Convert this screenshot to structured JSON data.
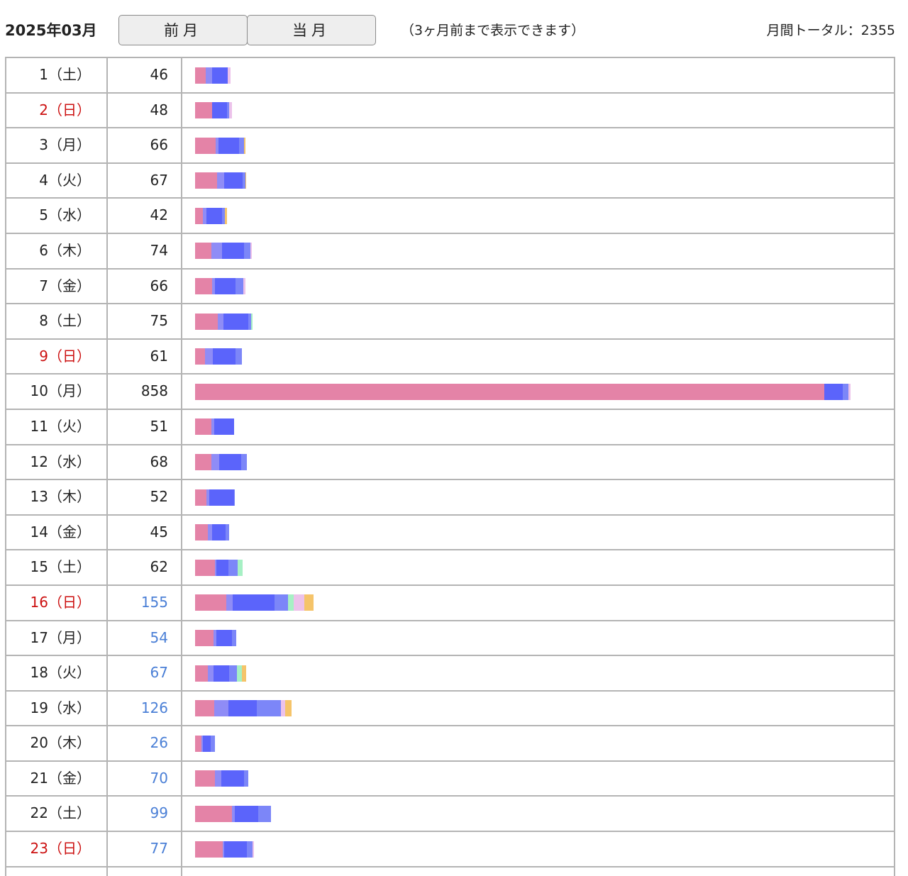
{
  "header": {
    "month_title": "2025年03月",
    "prev_label": "前月",
    "current_label": "当月",
    "note": "（3ヶ月前まで表示できます）",
    "total_label": "月間トータル：2355"
  },
  "colors": {
    "pink": "#e483a7",
    "lavender": "#8f8cf6",
    "blue": "#5b64fb",
    "periwinkle": "#7c86f8",
    "mint": "#a6f0c4",
    "light_pink": "#ecc2ea",
    "orange": "#f5c46a",
    "sunday_text": "#cc1111",
    "count_highlight": "#4a7fd6",
    "grid": "#b4b4b4"
  },
  "chart_data": {
    "type": "bar",
    "x_max": 858,
    "rows": [
      {
        "day": "1（土）",
        "count": "46",
        "value": 46,
        "sunday": false,
        "blue": false,
        "segments": [
          {
            "color": "pink",
            "v": 14
          },
          {
            "color": "lavender",
            "v": 8
          },
          {
            "color": "blue",
            "v": 21
          },
          {
            "color": "light_pink",
            "v": 3
          }
        ]
      },
      {
        "day": "2（日）",
        "count": "48",
        "value": 48,
        "sunday": true,
        "blue": false,
        "segments": [
          {
            "color": "pink",
            "v": 22
          },
          {
            "color": "blue",
            "v": 20
          },
          {
            "color": "periwinkle",
            "v": 3
          },
          {
            "color": "light_pink",
            "v": 3
          }
        ]
      },
      {
        "day": "3（月）",
        "count": "66",
        "value": 66,
        "sunday": false,
        "blue": false,
        "segments": [
          {
            "color": "pink",
            "v": 27
          },
          {
            "color": "lavender",
            "v": 4
          },
          {
            "color": "blue",
            "v": 27
          },
          {
            "color": "periwinkle",
            "v": 6
          },
          {
            "color": "orange",
            "v": 2
          }
        ]
      },
      {
        "day": "4（火）",
        "count": "67",
        "value": 67,
        "sunday": false,
        "blue": false,
        "segments": [
          {
            "color": "pink",
            "v": 29
          },
          {
            "color": "lavender",
            "v": 9
          },
          {
            "color": "blue",
            "v": 24
          },
          {
            "color": "periwinkle",
            "v": 4
          },
          {
            "color": "orange",
            "v": 1
          }
        ]
      },
      {
        "day": "5（水）",
        "count": "42",
        "value": 42,
        "sunday": false,
        "blue": false,
        "segments": [
          {
            "color": "pink",
            "v": 10
          },
          {
            "color": "lavender",
            "v": 5
          },
          {
            "color": "blue",
            "v": 20
          },
          {
            "color": "periwinkle",
            "v": 4
          },
          {
            "color": "orange",
            "v": 3
          }
        ]
      },
      {
        "day": "6（木）",
        "count": "74",
        "value": 74,
        "sunday": false,
        "blue": false,
        "segments": [
          {
            "color": "pink",
            "v": 21
          },
          {
            "color": "lavender",
            "v": 14
          },
          {
            "color": "blue",
            "v": 29
          },
          {
            "color": "periwinkle",
            "v": 8
          },
          {
            "color": "light_pink",
            "v": 2
          }
        ]
      },
      {
        "day": "7（金）",
        "count": "66",
        "value": 66,
        "sunday": false,
        "blue": false,
        "segments": [
          {
            "color": "pink",
            "v": 22
          },
          {
            "color": "lavender",
            "v": 4
          },
          {
            "color": "blue",
            "v": 27
          },
          {
            "color": "periwinkle",
            "v": 10
          },
          {
            "color": "light_pink",
            "v": 3
          }
        ]
      },
      {
        "day": "8（土）",
        "count": "75",
        "value": 75,
        "sunday": false,
        "blue": false,
        "segments": [
          {
            "color": "pink",
            "v": 30
          },
          {
            "color": "lavender",
            "v": 7
          },
          {
            "color": "blue",
            "v": 33
          },
          {
            "color": "periwinkle",
            "v": 3
          },
          {
            "color": "mint",
            "v": 2
          }
        ]
      },
      {
        "day": "9（日）",
        "count": "61",
        "value": 61,
        "sunday": true,
        "blue": false,
        "segments": [
          {
            "color": "pink",
            "v": 13
          },
          {
            "color": "lavender",
            "v": 10
          },
          {
            "color": "blue",
            "v": 30
          },
          {
            "color": "periwinkle",
            "v": 8
          }
        ]
      },
      {
        "day": "10（月）",
        "count": "858",
        "value": 858,
        "sunday": false,
        "blue": false,
        "segments": [
          {
            "color": "pink",
            "v": 824
          },
          {
            "color": "blue",
            "v": 24
          },
          {
            "color": "periwinkle",
            "v": 7
          },
          {
            "color": "light_pink",
            "v": 3
          }
        ]
      },
      {
        "day": "11（火）",
        "count": "51",
        "value": 51,
        "sunday": false,
        "blue": false,
        "segments": [
          {
            "color": "pink",
            "v": 21
          },
          {
            "color": "lavender",
            "v": 4
          },
          {
            "color": "blue",
            "v": 26
          }
        ]
      },
      {
        "day": "12（水）",
        "count": "68",
        "value": 68,
        "sunday": false,
        "blue": false,
        "segments": [
          {
            "color": "pink",
            "v": 21
          },
          {
            "color": "lavender",
            "v": 11
          },
          {
            "color": "blue",
            "v": 28
          },
          {
            "color": "periwinkle",
            "v": 8
          }
        ]
      },
      {
        "day": "13（木）",
        "count": "52",
        "value": 52,
        "sunday": false,
        "blue": false,
        "segments": [
          {
            "color": "pink",
            "v": 15
          },
          {
            "color": "lavender",
            "v": 4
          },
          {
            "color": "blue",
            "v": 32
          },
          {
            "color": "periwinkle",
            "v": 1
          }
        ]
      },
      {
        "day": "14（金）",
        "count": "45",
        "value": 45,
        "sunday": false,
        "blue": false,
        "segments": [
          {
            "color": "pink",
            "v": 17
          },
          {
            "color": "lavender",
            "v": 5
          },
          {
            "color": "blue",
            "v": 18
          },
          {
            "color": "periwinkle",
            "v": 5
          }
        ]
      },
      {
        "day": "15（土）",
        "count": "62",
        "value": 62,
        "sunday": false,
        "blue": false,
        "segments": [
          {
            "color": "pink",
            "v": 26
          },
          {
            "color": "lavender",
            "v": 2
          },
          {
            "color": "blue",
            "v": 16
          },
          {
            "color": "periwinkle",
            "v": 12
          },
          {
            "color": "mint",
            "v": 6
          }
        ]
      },
      {
        "day": "16（日）",
        "count": "155",
        "value": 155,
        "sunday": true,
        "blue": true,
        "segments": [
          {
            "color": "pink",
            "v": 41
          },
          {
            "color": "lavender",
            "v": 8
          },
          {
            "color": "blue",
            "v": 55
          },
          {
            "color": "periwinkle",
            "v": 18
          },
          {
            "color": "mint",
            "v": 7
          },
          {
            "color": "light_pink",
            "v": 14
          },
          {
            "color": "orange",
            "v": 12
          }
        ]
      },
      {
        "day": "17（月）",
        "count": "54",
        "value": 54,
        "sunday": false,
        "blue": true,
        "segments": [
          {
            "color": "pink",
            "v": 24
          },
          {
            "color": "lavender",
            "v": 4
          },
          {
            "color": "blue",
            "v": 20
          },
          {
            "color": "periwinkle",
            "v": 6
          }
        ]
      },
      {
        "day": "18（火）",
        "count": "67",
        "value": 67,
        "sunday": false,
        "blue": true,
        "segments": [
          {
            "color": "pink",
            "v": 17
          },
          {
            "color": "lavender",
            "v": 7
          },
          {
            "color": "blue",
            "v": 21
          },
          {
            "color": "periwinkle",
            "v": 10
          },
          {
            "color": "mint",
            "v": 6
          },
          {
            "color": "orange",
            "v": 6
          }
        ]
      },
      {
        "day": "19（水）",
        "count": "126",
        "value": 126,
        "sunday": false,
        "blue": true,
        "segments": [
          {
            "color": "pink",
            "v": 25
          },
          {
            "color": "lavender",
            "v": 19
          },
          {
            "color": "blue",
            "v": 37
          },
          {
            "color": "periwinkle",
            "v": 31
          },
          {
            "color": "light_pink",
            "v": 6
          },
          {
            "color": "orange",
            "v": 8
          }
        ]
      },
      {
        "day": "20（木）",
        "count": "26",
        "value": 26,
        "sunday": false,
        "blue": true,
        "segments": [
          {
            "color": "pink",
            "v": 8
          },
          {
            "color": "lavender",
            "v": 2
          },
          {
            "color": "blue",
            "v": 10
          },
          {
            "color": "periwinkle",
            "v": 6
          }
        ]
      },
      {
        "day": "21（金）",
        "count": "70",
        "value": 70,
        "sunday": false,
        "blue": true,
        "segments": [
          {
            "color": "pink",
            "v": 26
          },
          {
            "color": "lavender",
            "v": 8
          },
          {
            "color": "blue",
            "v": 30
          },
          {
            "color": "periwinkle",
            "v": 6
          }
        ]
      },
      {
        "day": "22（土）",
        "count": "99",
        "value": 99,
        "sunday": false,
        "blue": true,
        "segments": [
          {
            "color": "pink",
            "v": 48
          },
          {
            "color": "lavender",
            "v": 4
          },
          {
            "color": "blue",
            "v": 31
          },
          {
            "color": "periwinkle",
            "v": 16
          }
        ]
      },
      {
        "day": "23（日）",
        "count": "77",
        "value": 77,
        "sunday": true,
        "blue": true,
        "segments": [
          {
            "color": "pink",
            "v": 36
          },
          {
            "color": "lavender",
            "v": 2
          },
          {
            "color": "blue",
            "v": 30
          },
          {
            "color": "periwinkle",
            "v": 7
          },
          {
            "color": "light_pink",
            "v": 2
          }
        ]
      }
    ]
  }
}
